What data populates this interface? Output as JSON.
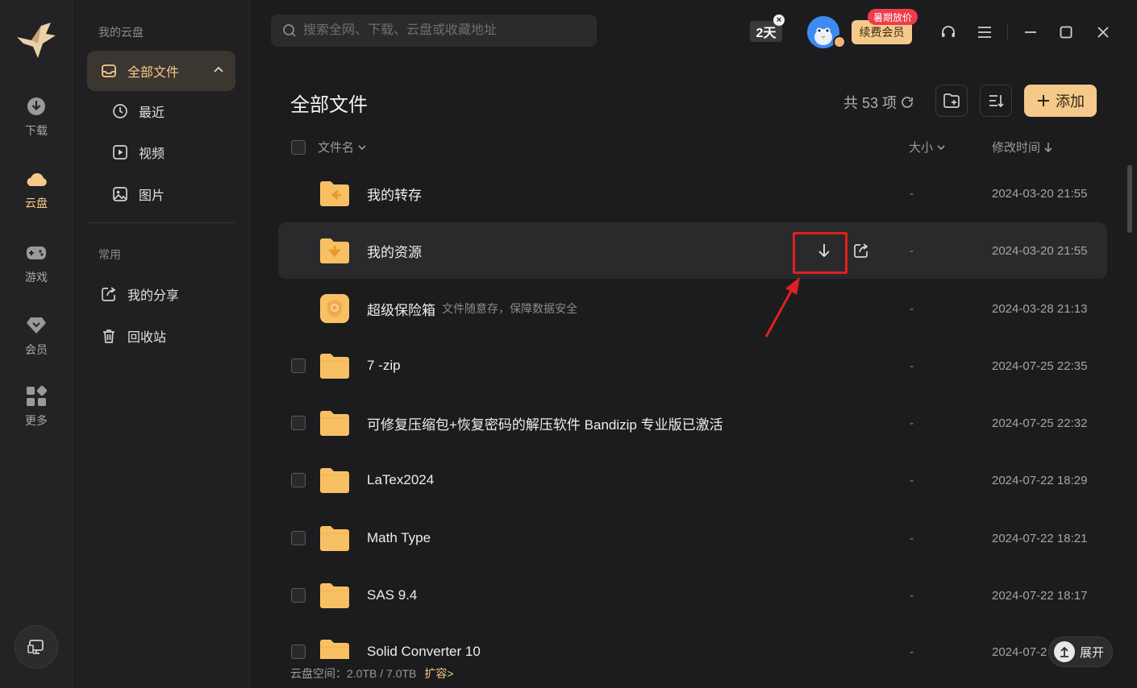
{
  "rail": {
    "items": [
      {
        "label": "下载",
        "icon": "download-icon"
      },
      {
        "label": "云盘",
        "icon": "cloud-icon",
        "active": true
      },
      {
        "label": "游戏",
        "icon": "gamepad-icon"
      },
      {
        "label": "会员",
        "icon": "diamond-icon"
      },
      {
        "label": "更多",
        "icon": "grid-icon"
      }
    ]
  },
  "sidebar": {
    "heading": "我的云盘",
    "all_files": "全部文件",
    "recent": "最近",
    "video": "视频",
    "images": "图片",
    "common_heading": "常用",
    "my_share": "我的分享",
    "recycle": "回收站"
  },
  "topbar": {
    "search_placeholder": "搜索全网、下载、云盘或收藏地址",
    "promo_days": "2天",
    "sale_tag": "暑期放价",
    "renew_label": "续费会员"
  },
  "header": {
    "title": "全部文件",
    "count": "共 53 项",
    "add_label": "添加"
  },
  "columns": {
    "name": "文件名",
    "size": "大小",
    "modified": "修改时间"
  },
  "files": [
    {
      "name": "我的转存",
      "size": "-",
      "date": "2024-03-20 21:55",
      "kind": "transfer"
    },
    {
      "name": "我的资源",
      "size": "-",
      "date": "2024-03-20 21:55",
      "kind": "resource"
    },
    {
      "name": "超级保险箱",
      "hint": "文件随意存，保障数据安全",
      "size": "-",
      "date": "2024-03-28 21:13",
      "kind": "safe"
    },
    {
      "name": "7 -zip",
      "size": "-",
      "date": "2024-07-25 22:35",
      "kind": "folder"
    },
    {
      "name": "可修复压缩包+恢复密码的解压软件 Bandizip 专业版已激活",
      "size": "-",
      "date": "2024-07-25 22:32",
      "kind": "folder"
    },
    {
      "name": "LaTex2024",
      "size": "-",
      "date": "2024-07-22 18:29",
      "kind": "folder"
    },
    {
      "name": "Math Type",
      "size": "-",
      "date": "2024-07-22 18:21",
      "kind": "folder"
    },
    {
      "name": "SAS 9.4",
      "size": "-",
      "date": "2024-07-22 18:17",
      "kind": "folder"
    },
    {
      "name": "Solid Converter 10",
      "size": "-",
      "date": "2024-07-2",
      "kind": "folder"
    }
  ],
  "footer": {
    "storage": "云盘空间：2.0TB / 7.0TB",
    "expand_storage": "扩容>",
    "expand_button": "展开"
  },
  "colors": {
    "accent": "#f5c98a",
    "folder": "#f7c163",
    "highlight_box": "#e02020"
  }
}
